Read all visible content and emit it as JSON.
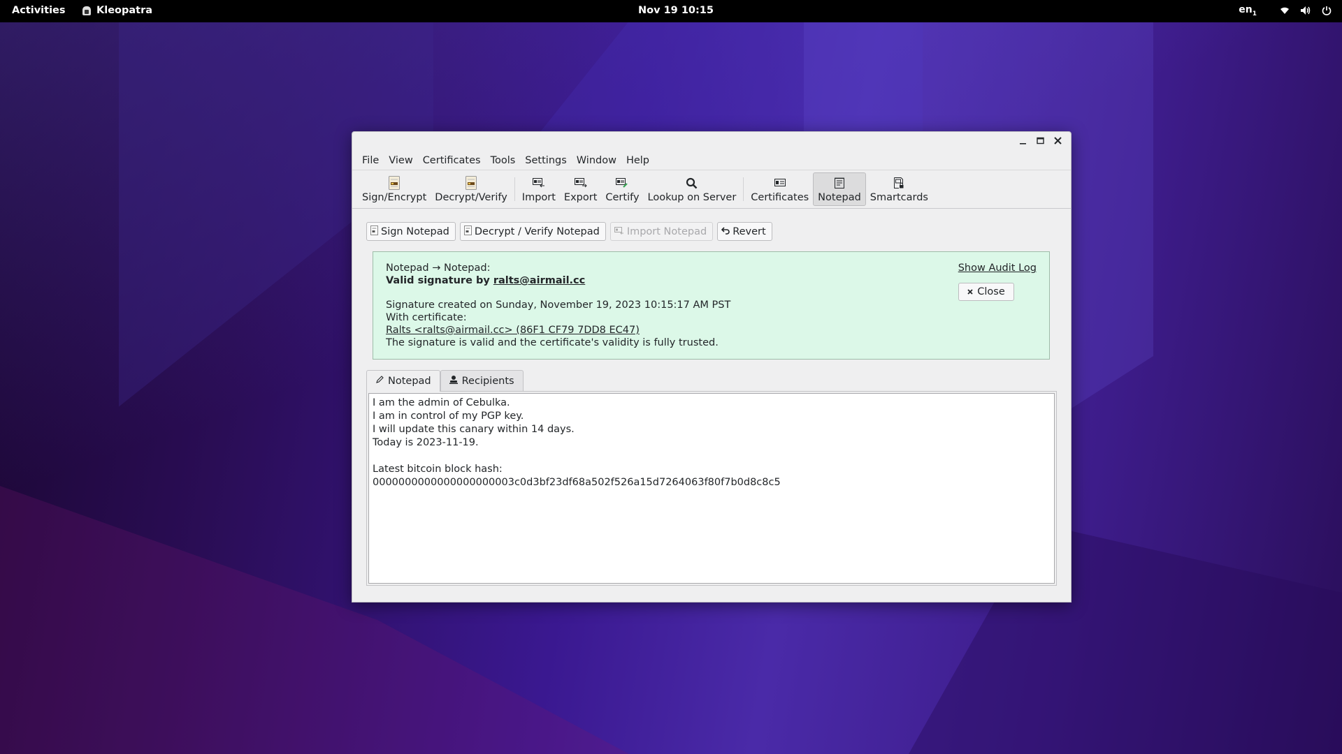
{
  "topbar": {
    "activities": "Activities",
    "app_name": "Kleopatra",
    "clock": "Nov 19  10:15",
    "keyboard_layout": "en",
    "keyboard_layout_sub": "1",
    "tray_icons": [
      "wifi-icon",
      "volume-icon",
      "power-icon"
    ]
  },
  "window": {
    "controls": [
      "minimize",
      "maximize",
      "close"
    ],
    "menu": [
      "File",
      "View",
      "Certificates",
      "Tools",
      "Settings",
      "Window",
      "Help"
    ],
    "toolbar": [
      {
        "label": "Sign/Encrypt",
        "icon": "document-sign-icon"
      },
      {
        "label": "Decrypt/Verify",
        "icon": "document-decrypt-icon"
      },
      {
        "label": "Import",
        "icon": "certificate-import-icon"
      },
      {
        "label": "Export",
        "icon": "certificate-export-icon"
      },
      {
        "label": "Certify",
        "icon": "certificate-certify-icon"
      },
      {
        "label": "Lookup on Server",
        "icon": "search-icon"
      },
      {
        "label": "Certificates",
        "icon": "certificates-icon"
      },
      {
        "label": "Notepad",
        "icon": "notepad-icon",
        "active": true
      },
      {
        "label": "Smartcards",
        "icon": "smartcard-icon"
      }
    ],
    "actions": {
      "sign": "Sign Notepad",
      "decrypt_verify": "Decrypt / Verify Notepad",
      "import": "Import Notepad",
      "import_disabled": true,
      "revert": "Revert"
    },
    "result": {
      "header": "Notepad → Notepad:",
      "valid_prefix": "Valid signature by ",
      "signer_email": "ralts@airmail.cc",
      "created": "Signature created on Sunday, November 19, 2023 10:15:17 AM PST",
      "with_cert": "With certificate:",
      "certificate": "Ralts <ralts@airmail.cc> (86F1 CF79 7DD8 EC47)",
      "validity": "The signature is valid and the certificate's validity is fully trusted.",
      "show_audit_log": "Show Audit Log",
      "close": "Close",
      "status_color": "#dcf8e8"
    },
    "tabs": [
      {
        "label": "Notepad",
        "icon": "pencil-icon",
        "active": true
      },
      {
        "label": "Recipients",
        "icon": "user-icon",
        "active": false
      }
    ],
    "notepad_text": "I am the admin of Cebulka.\nI am in control of my PGP key.\nI will update this canary within 14 days.\nToday is 2023-11-19.\n\nLatest bitcoin block hash:\n0000000000000000000003c0d3bf23df68a502f526a15d7264063f80f7b0d8c8c5"
  }
}
